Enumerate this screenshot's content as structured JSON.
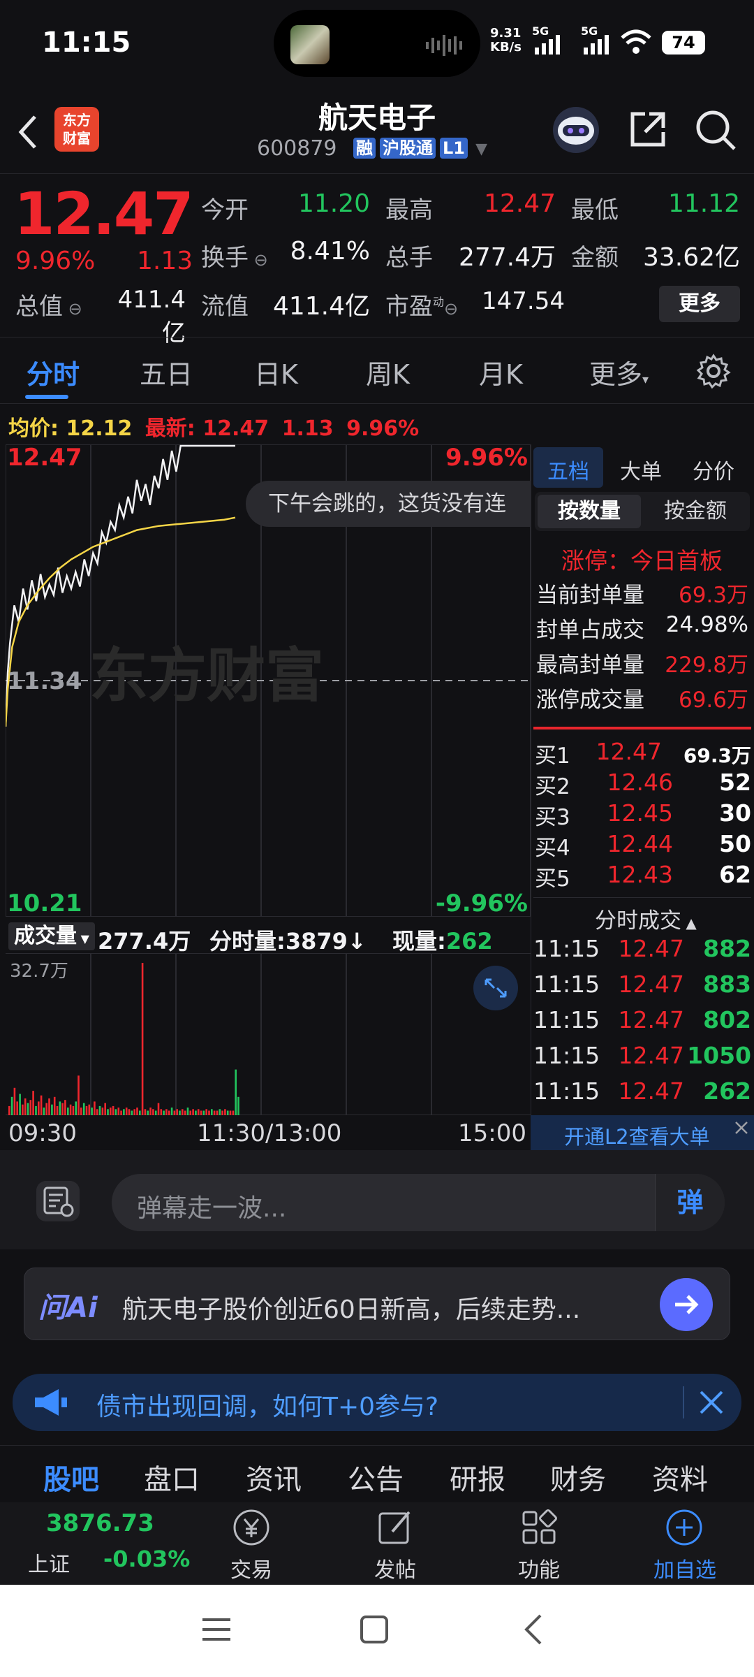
{
  "status_bar": {
    "time": "11:15",
    "net_speed_value": "9.31",
    "net_speed_unit": "KB/s",
    "sim1": "5G",
    "sim2": "5G",
    "battery": "74"
  },
  "header": {
    "logo_text_1": "东方",
    "logo_text_2": "财富",
    "title": "航天电子",
    "code": "600879",
    "tags": [
      "融",
      "沪股通",
      "L1"
    ]
  },
  "quote": {
    "price": "12.47",
    "change_pct": "9.96%",
    "change": "1.13",
    "fields": {
      "open_label": "今开",
      "open": "11.20",
      "high_label": "最高",
      "high": "12.47",
      "low_label": "最低",
      "low": "11.12",
      "turnover_label": "换手",
      "turnover": "8.41%",
      "volume_label": "总手",
      "volume": "277.4万",
      "amount_label": "金额",
      "amount": "33.62亿",
      "mcap_label": "总值",
      "mcap": "411.4亿",
      "float_label": "流值",
      "float": "411.4亿",
      "pe_label": "市盈",
      "pe_sup": "动",
      "pe": "147.54"
    },
    "more_label": "更多"
  },
  "tabs": [
    "分时",
    "五日",
    "日K",
    "周K",
    "月K",
    "更多"
  ],
  "avg_row": {
    "avg_label": "均价:",
    "avg": "12.12",
    "latest_label": "最新:",
    "latest": "12.47",
    "change": "1.13",
    "pct": "9.96%"
  },
  "chart_data": {
    "type": "line",
    "title": "",
    "series": [
      {
        "name": "",
        "color": "#f2f2f4",
        "x": [
          "09:30",
          "09:31",
          "09:32",
          "09:34",
          "09:36",
          "09:38",
          "09:40",
          "09:42",
          "09:44",
          "09:46",
          "09:48",
          "09:50",
          "09:52",
          "09:54",
          "09:56",
          "09:58",
          "10:00",
          "10:02",
          "10:04",
          "10:06",
          "10:08",
          "10:10",
          "10:12",
          "10:14",
          "10:16",
          "10:18",
          "10:20",
          "10:22",
          "10:24",
          "10:26",
          "10:28",
          "10:30",
          "10:32",
          "10:34",
          "10:36",
          "10:38",
          "10:40",
          "10:42",
          "10:44",
          "10:46",
          "10:48",
          "10:50",
          "10:52",
          "10:54",
          "10:56",
          "10:58",
          "11:00",
          "11:05",
          "11:10",
          "11:15"
        ],
        "values": [
          11.12,
          11.38,
          11.52,
          11.7,
          11.62,
          11.78,
          11.68,
          11.82,
          11.72,
          11.85,
          11.74,
          11.8,
          11.75,
          11.88,
          11.76,
          11.84,
          11.78,
          11.86,
          11.79,
          11.92,
          11.84,
          11.95,
          11.9,
          12.05,
          12.0,
          12.1,
          12.06,
          12.18,
          12.12,
          12.22,
          12.14,
          12.3,
          12.2,
          12.28,
          12.18,
          12.32,
          12.26,
          12.4,
          12.3,
          12.44,
          12.34,
          12.47,
          12.47,
          12.47,
          12.47,
          12.47,
          12.47,
          12.47,
          12.47,
          12.47
        ]
      },
      {
        "name": "",
        "color": "#f5d547",
        "x": [
          "09:30",
          "09:31",
          "09:33",
          "09:36",
          "09:40",
          "09:45",
          "09:50",
          "09:55",
          "10:00",
          "10:10",
          "10:20",
          "10:30",
          "10:40",
          "10:50",
          "11:00",
          "11:10",
          "11:15"
        ],
        "values": [
          11.12,
          11.3,
          11.5,
          11.62,
          11.7,
          11.77,
          11.83,
          11.88,
          11.92,
          11.98,
          12.02,
          12.06,
          12.08,
          12.09,
          12.1,
          12.11,
          12.12
        ]
      }
    ],
    "ylim": [
      10.21,
      12.47
    ],
    "yticks": [
      "12.47",
      "11.34",
      "10.21"
    ],
    "pct_ticks": [
      "9.96%",
      "-9.96%"
    ],
    "xticks": [
      "09:30",
      "11:30/13:00",
      "15:00"
    ],
    "volume": {
      "max_label": "32.7万",
      "bars": [
        6,
        12,
        18,
        9,
        14,
        7,
        11,
        8,
        10,
        16,
        6,
        9,
        13,
        5,
        8,
        11,
        7,
        12,
        6,
        9,
        8,
        10,
        5,
        7,
        6,
        9,
        26,
        5,
        8,
        6,
        7,
        5,
        9,
        4,
        6,
        5,
        8,
        4,
        5,
        6,
        4,
        5,
        3,
        4,
        5,
        4,
        3,
        4,
        5,
        3,
        100,
        4,
        3,
        5,
        4,
        3,
        8,
        4,
        3,
        4,
        3,
        5,
        3,
        4,
        3,
        4,
        3,
        5,
        3,
        4,
        3,
        4,
        3,
        3,
        4,
        3,
        4,
        3,
        3,
        4,
        3,
        4,
        3,
        3,
        3,
        30,
        12
      ]
    },
    "watermark": "东方财富"
  },
  "volume_legend": {
    "label": "成交量",
    "total": "277.4万",
    "period_label": "分时量:",
    "period": "3879",
    "now_label": "现量:",
    "now": "262"
  },
  "danmu_bubble": "下午会跳的，这货没有连",
  "right_panel": {
    "tabs": [
      "五档",
      "大单",
      "分价"
    ],
    "seg": [
      "按数量",
      "按金额"
    ],
    "limit_title": "涨停：今日首板",
    "stats": [
      {
        "label": "当前封单量",
        "value": "69.3万"
      },
      {
        "label": "封单占成交",
        "value": "24.98%"
      },
      {
        "label": "最高封单量",
        "value": "229.8万"
      },
      {
        "label": "涨停成交量",
        "value": "69.6万"
      }
    ],
    "orderbook": [
      {
        "label": "买1",
        "price": "12.47",
        "vol": "69.3万"
      },
      {
        "label": "买2",
        "price": "12.46",
        "vol": "52"
      },
      {
        "label": "买3",
        "price": "12.45",
        "vol": "30"
      },
      {
        "label": "买4",
        "price": "12.44",
        "vol": "50"
      },
      {
        "label": "买5",
        "price": "12.43",
        "vol": "62"
      }
    ],
    "trades_title": "分时成交",
    "trades": [
      {
        "time": "11:15",
        "price": "12.47",
        "vol": "882"
      },
      {
        "time": "11:15",
        "price": "12.47",
        "vol": "883"
      },
      {
        "time": "11:15",
        "price": "12.47",
        "vol": "802"
      },
      {
        "time": "11:15",
        "price": "12.47",
        "vol": "1050"
      },
      {
        "time": "11:15",
        "price": "12.47",
        "vol": "262"
      }
    ],
    "l2_link": "开通L2查看大单"
  },
  "barrage": {
    "placeholder": "弹幕走一波...",
    "button": "弹"
  },
  "ai_bar": {
    "logo": "问Ai",
    "text": "航天电子股价创近60日新高，后续走势..."
  },
  "notice": {
    "text": "债市出现回调，如何T+0参与?"
  },
  "bottom_tabs": [
    "股吧",
    "盘口",
    "资讯",
    "公告",
    "研报",
    "财务",
    "资料"
  ],
  "nav": {
    "index_value": "3876.73",
    "index_name": "上证",
    "index_change": "-0.03%",
    "items": [
      "交易",
      "发帖",
      "功能",
      "加自选"
    ]
  },
  "colors": {
    "up": "#f0262d",
    "down": "#22c55e",
    "accent": "#3c8cff",
    "avg_line": "#f5d547",
    "price_line": "#f2f2f4"
  }
}
